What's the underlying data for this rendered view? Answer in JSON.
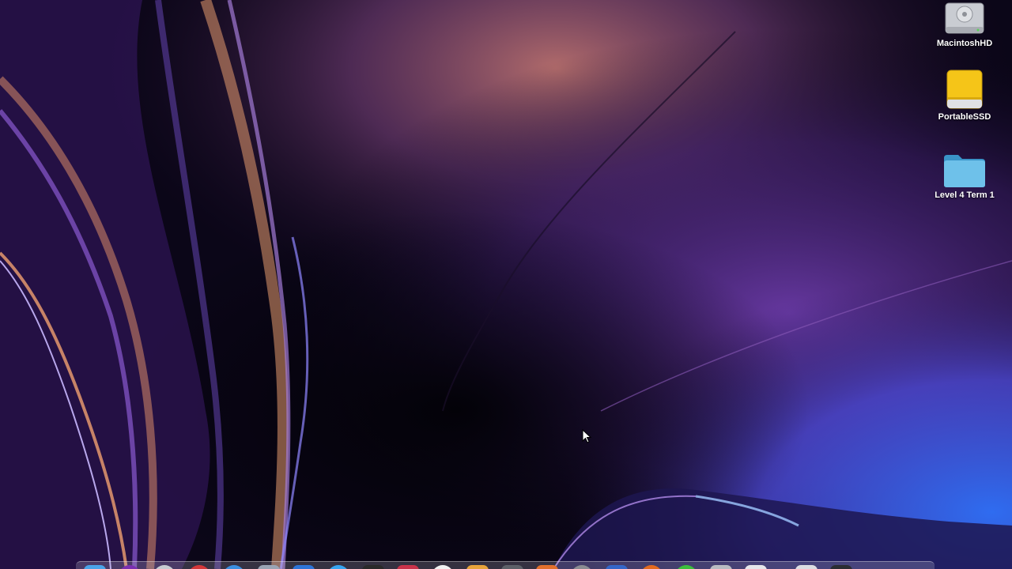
{
  "desktop": {
    "icons": [
      {
        "label": "MacintoshHD",
        "icon": "hard-drive-icon"
      },
      {
        "label": "PortableSSD",
        "icon": "external-drive-icon"
      },
      {
        "label": "Level 4 Term 1",
        "icon": "folder-icon"
      }
    ]
  },
  "dock": {
    "apps": [
      {
        "icon": "finder-icon",
        "color": "#4aa3e8"
      },
      {
        "icon": "siri-icon",
        "color": "#7a2fb0"
      },
      {
        "icon": "launchpad-icon",
        "color": "#c8ccd2"
      },
      {
        "icon": "app-red-icon",
        "color": "#d4383a"
      },
      {
        "icon": "safari-icon",
        "color": "#3b8fe0"
      },
      {
        "icon": "app-globe-icon",
        "color": "#9aa4b4"
      },
      {
        "icon": "app-blue-icon",
        "color": "#2d74d8"
      },
      {
        "icon": "app-sky-icon",
        "color": "#36a4f0"
      },
      {
        "icon": "terminal-icon",
        "color": "#2a2a2a"
      },
      {
        "icon": "app-crimson-icon",
        "color": "#c9324a"
      },
      {
        "icon": "app-white-red-icon",
        "color": "#f2f2f2"
      },
      {
        "icon": "app-orange-icon",
        "color": "#e8a33a"
      },
      {
        "icon": "app-gray-icon",
        "color": "#5d6068"
      },
      {
        "icon": "app-flame-icon",
        "color": "#e2702c"
      },
      {
        "icon": "system-preferences-icon",
        "color": "#8a8c92"
      },
      {
        "icon": "app-grid-icon",
        "color": "#3466c8"
      },
      {
        "icon": "app-orange-round-icon",
        "color": "#e46a1e"
      },
      {
        "icon": "app-green-icon",
        "color": "#3cbf3c"
      },
      {
        "icon": "app-silver-icon",
        "color": "#b9bcc2"
      },
      {
        "icon": "document-icon",
        "color": "#e6e6ea"
      },
      {
        "icon": "folder-stack-icon",
        "color": "#dcdde2"
      },
      {
        "icon": "trash-icon",
        "color": "#2b2d33"
      }
    ]
  }
}
